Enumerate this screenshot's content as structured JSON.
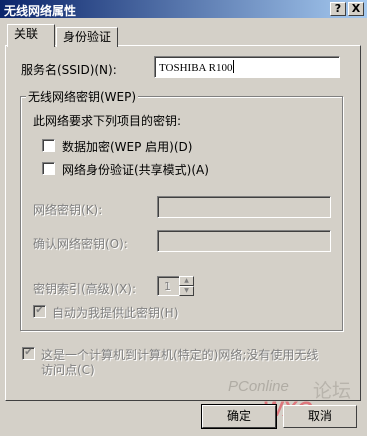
{
  "window": {
    "title": "无线网络属性",
    "title_buttons": [
      "?",
      "X"
    ]
  },
  "tabs": [
    {
      "label": "关联",
      "active": true
    },
    {
      "label": "身份验证",
      "active": false
    }
  ],
  "ssid": {
    "label": "服务名(SSID)(N):",
    "value": "TOSHIBA R100"
  },
  "wep_group": {
    "title": "无线网络密钥(WEP)",
    "requirement_text": "此网络要求下列项目的密钥:",
    "data_encryption": {
      "label": "数据加密(WEP 启用)(D)",
      "checked": false
    },
    "network_auth": {
      "label": "网络身份验证(共享模式)(A)",
      "checked": false
    },
    "network_key_label": "网络密钥(K):",
    "network_key_value": "",
    "confirm_key_label": "确认网络密钥(O):",
    "confirm_key_value": "",
    "key_index_label": "密钥索引(高级)(X):",
    "key_index_value": "1",
    "auto_provide": {
      "label": "自动为我提供此密钥(H)",
      "checked": true
    }
  },
  "adhoc": {
    "label_line1": "这是一个计算机到计算机(特定的)网络;没有使用无线",
    "label_line2": "访问点(C)",
    "checked": true
  },
  "buttons": {
    "ok": "确定",
    "cancel": "取消"
  },
  "watermark": {
    "site": "PConline",
    "forum": "论坛"
  }
}
